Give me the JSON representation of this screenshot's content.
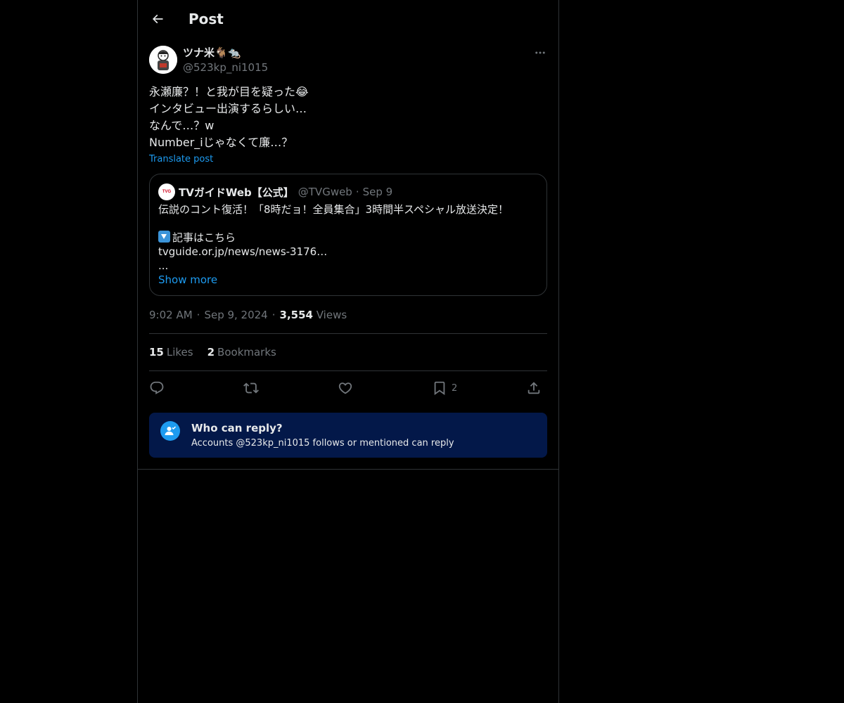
{
  "header": {
    "title": "Post"
  },
  "author": {
    "display_name": "ツナ米🐐🐀",
    "handle": "@523kp_ni1015"
  },
  "tweet": {
    "lines": [
      "永瀬廉？！と我が目を疑った😂",
      "インタビュー出演するらしい…",
      "なんで…？w",
      "Number_iじゃなくて廉…？"
    ],
    "translate_label": "Translate post"
  },
  "quote": {
    "avatar_text": "TVG",
    "name": "TVガイドWeb【公式】",
    "handle": "@TVGweb",
    "separator": "·",
    "date": "Sep 9",
    "line1": "伝説のコント復活！「8時だョ！全員集合」3時間半スペシャル放送決定！",
    "line2": "記事はこちら",
    "line3": "tvguide.or.jp/news/news-3176…",
    "line4": "...",
    "show_more": "Show more"
  },
  "meta": {
    "time": "9:02 AM",
    "date": "Sep 9, 2024",
    "separator": "·",
    "views_count": "3,554",
    "views_label": "Views"
  },
  "stats": {
    "likes_count": "15",
    "likes_label": "Likes",
    "bookmarks_count": "2",
    "bookmarks_label": "Bookmarks"
  },
  "actions": {
    "bookmark_count": "2"
  },
  "reply_notice": {
    "title": "Who can reply?",
    "subtitle": "Accounts @523kp_ni1015 follows or mentioned can reply"
  },
  "colors": {
    "background": "#000000",
    "accent": "#1d9bf0",
    "muted_text": "#71767b",
    "border": "#2f3336",
    "reply_box_bg": "#031849"
  }
}
